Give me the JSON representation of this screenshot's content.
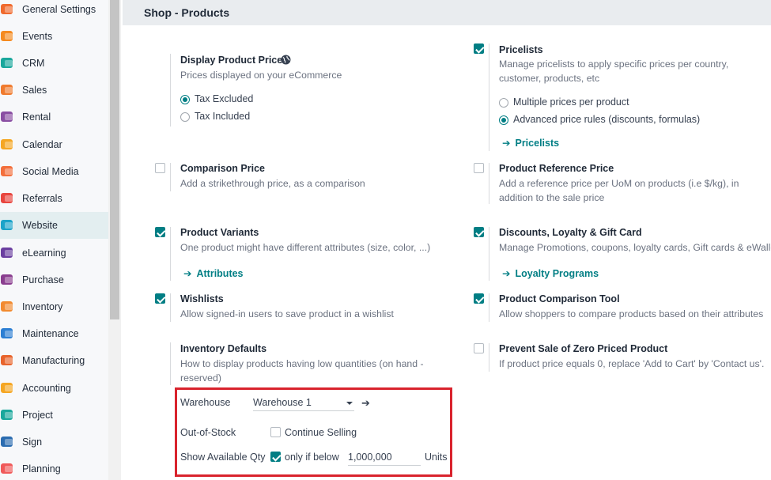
{
  "sidebar": {
    "items": [
      {
        "label": "General Settings",
        "icon": "general-settings-icon",
        "color": "#f06a2e"
      },
      {
        "label": "Events",
        "icon": "events-icon",
        "color": "#f58a1f"
      },
      {
        "label": "CRM",
        "icon": "crm-icon",
        "color": "#1aa79c"
      },
      {
        "label": "Sales",
        "icon": "sales-icon",
        "color": "#f07b2e"
      },
      {
        "label": "Rental",
        "icon": "rental-icon",
        "color": "#8a4fa3"
      },
      {
        "label": "Calendar",
        "icon": "calendar-icon",
        "color": "#f5a623"
      },
      {
        "label": "Social Media",
        "icon": "social-media-icon",
        "color": "#f36f3c"
      },
      {
        "label": "Referrals",
        "icon": "referrals-icon",
        "color": "#e8463f"
      },
      {
        "label": "Website",
        "icon": "website-icon",
        "color": "#1ba3c9"
      },
      {
        "label": "eLearning",
        "icon": "elearning-icon",
        "color": "#6b3fa0"
      },
      {
        "label": "Purchase",
        "icon": "purchase-icon",
        "color": "#8a3e8f"
      },
      {
        "label": "Inventory",
        "icon": "inventory-icon",
        "color": "#f28b30"
      },
      {
        "label": "Maintenance",
        "icon": "maintenance-icon",
        "color": "#2d7fd3"
      },
      {
        "label": "Manufacturing",
        "icon": "manufacturing-icon",
        "color": "#e8642c"
      },
      {
        "label": "Accounting",
        "icon": "accounting-icon",
        "color": "#f5a623"
      },
      {
        "label": "Project",
        "icon": "project-icon",
        "color": "#1aa79c"
      },
      {
        "label": "Sign",
        "icon": "sign-icon",
        "color": "#2b6cb0"
      },
      {
        "label": "Planning",
        "icon": "planning-icon",
        "color": "#f05a5a"
      }
    ],
    "active": "Website"
  },
  "header": {
    "title": "Shop - Products"
  },
  "settings": {
    "display_prices": {
      "title": "Display Product Prices",
      "desc": "Prices displayed on your eCommerce",
      "options": [
        "Tax Excluded",
        "Tax Included"
      ],
      "selected": "Tax Excluded"
    },
    "pricelists": {
      "title": "Pricelists",
      "desc": "Manage pricelists to apply specific prices per country, customer, products, etc",
      "options": [
        "Multiple prices per product",
        "Advanced price rules (discounts, formulas)"
      ],
      "selected": "Advanced price rules (discounts, formulas)",
      "link": "Pricelists",
      "checked": true
    },
    "comparison_price": {
      "title": "Comparison Price",
      "desc": "Add a strikethrough price, as a comparison",
      "checked": false
    },
    "reference_price": {
      "title": "Product Reference Price",
      "desc": "Add a reference price per UoM on products (i.e $/kg), in addition to the sale price",
      "checked": false
    },
    "variants": {
      "title": "Product Variants",
      "desc": "One product might have different attributes (size, color, ...)",
      "link": "Attributes",
      "checked": true
    },
    "discounts": {
      "title": "Discounts, Loyalty & Gift Card",
      "desc": "Manage Promotions, coupons, loyalty cards, Gift cards & eWallet",
      "link": "Loyalty Programs",
      "checked": true
    },
    "wishlists": {
      "title": "Wishlists",
      "desc": "Allow signed-in users to save product in a wishlist",
      "checked": true
    },
    "comparison_tool": {
      "title": "Product Comparison Tool",
      "desc": "Allow shoppers to compare products based on their attributes",
      "checked": true
    },
    "inventory_defaults": {
      "title": "Inventory Defaults",
      "desc": "How to display products having low quantities (on hand - reserved)",
      "warehouse_label": "Warehouse",
      "warehouse_value": "Warehouse 1",
      "out_of_stock_label": "Out-of-Stock",
      "continue_selling_label": "Continue Selling",
      "continue_selling_checked": false,
      "show_qty_label": "Show Available Qty",
      "only_if_below_label": "only if below",
      "only_if_below_checked": true,
      "threshold": "1,000,000",
      "units": "Units"
    },
    "zero_price": {
      "title": "Prevent Sale of Zero Priced Product",
      "desc": "If product price equals 0, replace 'Add to Cart' by 'Contact us'.",
      "checked": false
    }
  },
  "arrow_glyph": "➔",
  "accent_color": "#017e84",
  "highlight_color": "#d9232d"
}
